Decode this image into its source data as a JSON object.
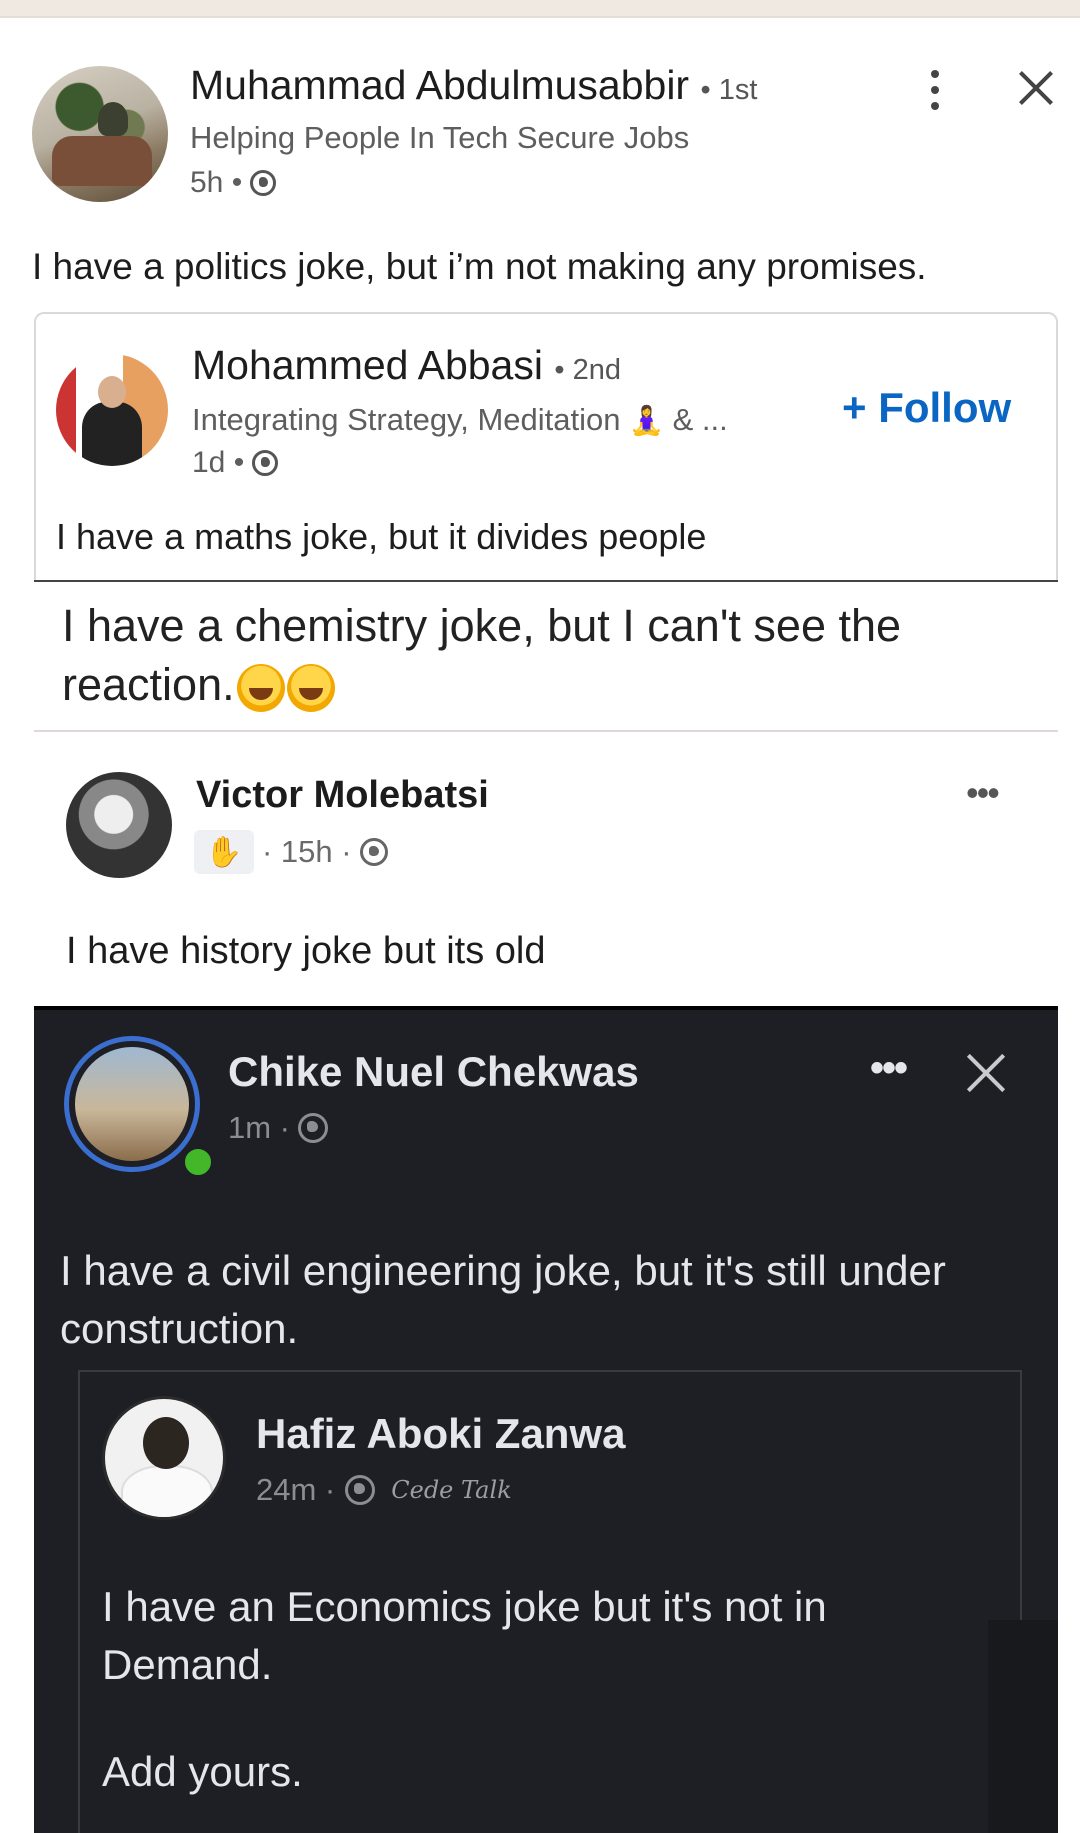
{
  "outer_post": {
    "author_name": "Muhammad Abdulmusabbir",
    "degree": "• 1st",
    "headline": "Helping People In Tech Secure Jobs",
    "time": "5h •",
    "text": "I have a politics joke, but i’m not making any promises."
  },
  "shared_post": {
    "author_name": "Mohammed Abbasi",
    "degree": "• 2nd",
    "headline": "Integrating Strategy, Meditation",
    "headline_emoji": "🧘‍♀️",
    "headline_tail": "& ...",
    "time": "1d •",
    "follow_label": "+ Follow",
    "text": "I have a maths joke, but it divides people"
  },
  "chemistry_post": {
    "text": "I have a chemistry joke, but I can't see the reaction."
  },
  "fb_post_1": {
    "author_name": "Victor Molebatsi",
    "time": "· 15h ·",
    "more_label": "•••",
    "text": "I have history joke but its old"
  },
  "fb_post_2": {
    "author_name": "Chike Nuel Chekwas",
    "time": "1m ·",
    "more_label": "•••",
    "text": "I have a civil engineering joke, but it's still under construction."
  },
  "fb_post_3": {
    "author_name": "Hafiz Aboki Zanwa",
    "time": "24m ·",
    "watermark": "Cede Talk",
    "text": "I have an Economics joke but it's not in Demand.",
    "cta": "Add yours."
  },
  "colors": {
    "linkedin_blue": "#0a66c2",
    "fb_dark_bg": "#1d1f24",
    "online_green": "#42b72a"
  }
}
